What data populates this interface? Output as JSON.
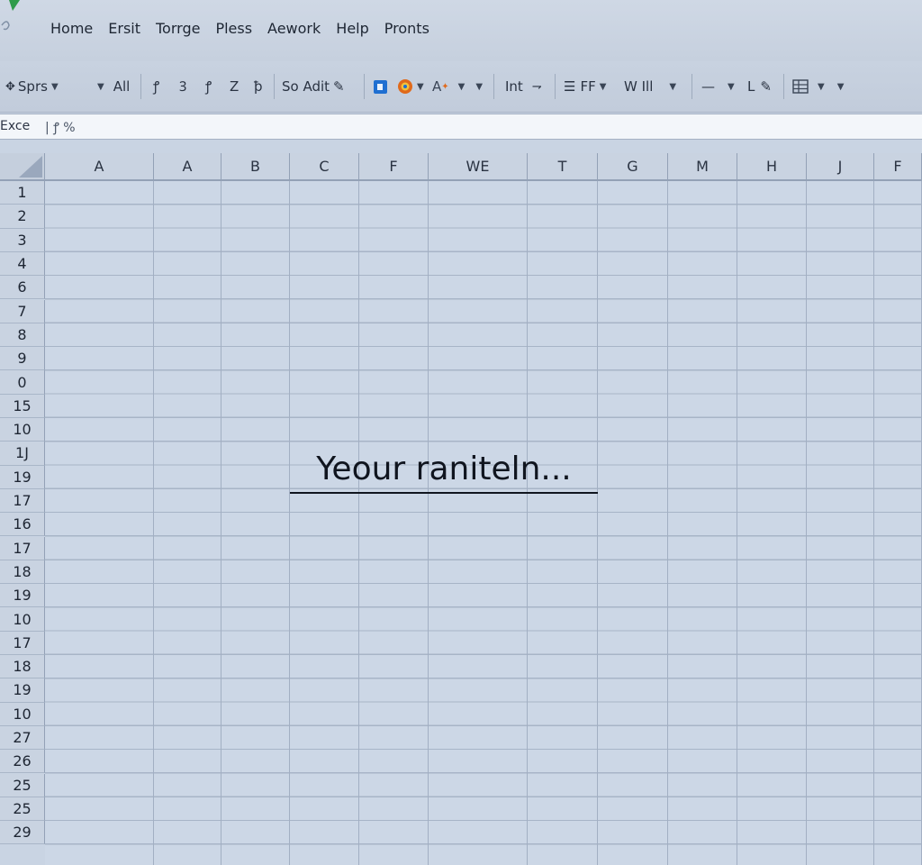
{
  "menubar": {
    "items": [
      "Home",
      "Ersit",
      "Torrge",
      "Pless",
      "Aework",
      "Help",
      "Pronts"
    ]
  },
  "toolbar": {
    "font_label": "Sprs",
    "all_label": "All",
    "glyph1": "ꝭ",
    "glyph2": "Ꝫ",
    "glyph3": "ꝭ",
    "glyph4": "Z",
    "glyph5": "ꝥ",
    "so_adit_label": "So Adit",
    "int_label": "Int",
    "ff_label": "FF",
    "wll_label": "W Ill",
    "l_label": "L"
  },
  "formula_bar": {
    "name_box": "Exce",
    "fx": "| ꝭ %"
  },
  "sheet": {
    "columns": [
      "A",
      "A",
      "B",
      "C",
      "F",
      "WE",
      "T",
      "G",
      "M",
      "H",
      "J",
      "F"
    ],
    "rows": [
      "1",
      "2",
      "3",
      "4",
      "6",
      "7",
      "8",
      "9",
      "0",
      "15",
      "10",
      "1J",
      "19",
      "17",
      "16",
      "17",
      "18",
      "19",
      "10",
      "17",
      "18",
      "19",
      "10",
      "27",
      "26",
      "25",
      "25",
      "29"
    ]
  },
  "overlay": {
    "text": "Yeour raniteln..."
  },
  "colors": {
    "accent_green": "#2e9b4a",
    "icon_blue": "#1f6fd1",
    "icon_orange": "#e06a1b"
  }
}
